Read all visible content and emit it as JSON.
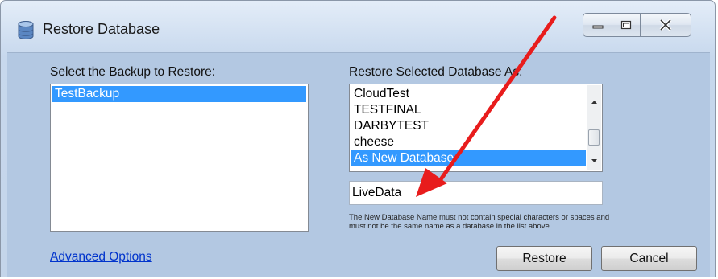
{
  "window": {
    "title": "Restore Database"
  },
  "left_panel": {
    "label": "Select the Backup to Restore:",
    "items": [
      "TestBackup"
    ],
    "selected_index": 0
  },
  "right_panel": {
    "label": "Restore Selected Database As:",
    "items": [
      "CloudTest",
      "TESTFINAL",
      "DARBYTEST",
      "cheese",
      "As New Database"
    ],
    "selected_index": 4,
    "new_name_value": "LiveData",
    "hint": "The New Database Name must not contain special characters or spaces and must not be the same name as a database in the list above."
  },
  "footer": {
    "advanced_link": "Advanced Options",
    "restore_button": "Restore",
    "cancel_button": "Cancel"
  },
  "annotation": {
    "arrow_color": "#e81c1c"
  },
  "colors": {
    "selection": "#3399ff",
    "link": "#0033cc",
    "client_bg": "#b3c8e2"
  }
}
